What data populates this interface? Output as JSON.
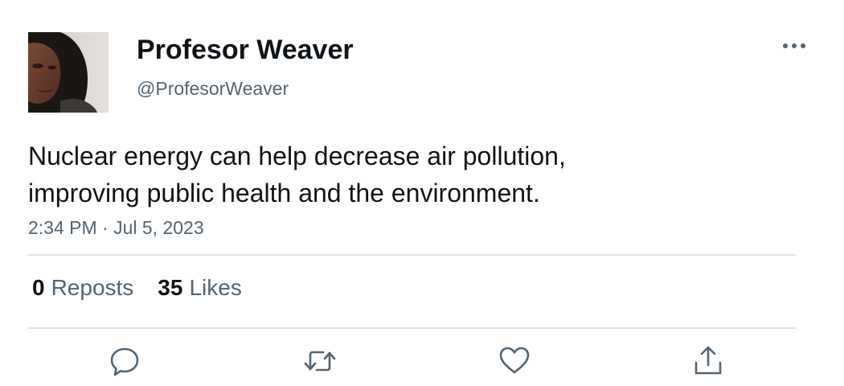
{
  "author": {
    "display_name": "Profesor Weaver",
    "handle": "@ProfesorWeaver",
    "avatar": "profile-photo"
  },
  "tweet": {
    "text": "Nuclear energy can help decrease air pollution,\nimproving public health and the environment.",
    "timestamp": "2:34 PM · Jul 5, 2023"
  },
  "stats": {
    "reposts_count": "0",
    "reposts_label": "Reposts",
    "likes_count": "35",
    "likes_label": "Likes"
  },
  "actions": {
    "more_icon": "more-horizontal-icon",
    "reply_icon": "reply-bubble-icon",
    "repost_icon": "repost-arrows-icon",
    "like_icon": "heart-icon",
    "share_icon": "share-upload-icon"
  },
  "colors": {
    "text_primary": "#0f1419",
    "text_secondary": "#536471",
    "divider": "#dfe3e6"
  }
}
